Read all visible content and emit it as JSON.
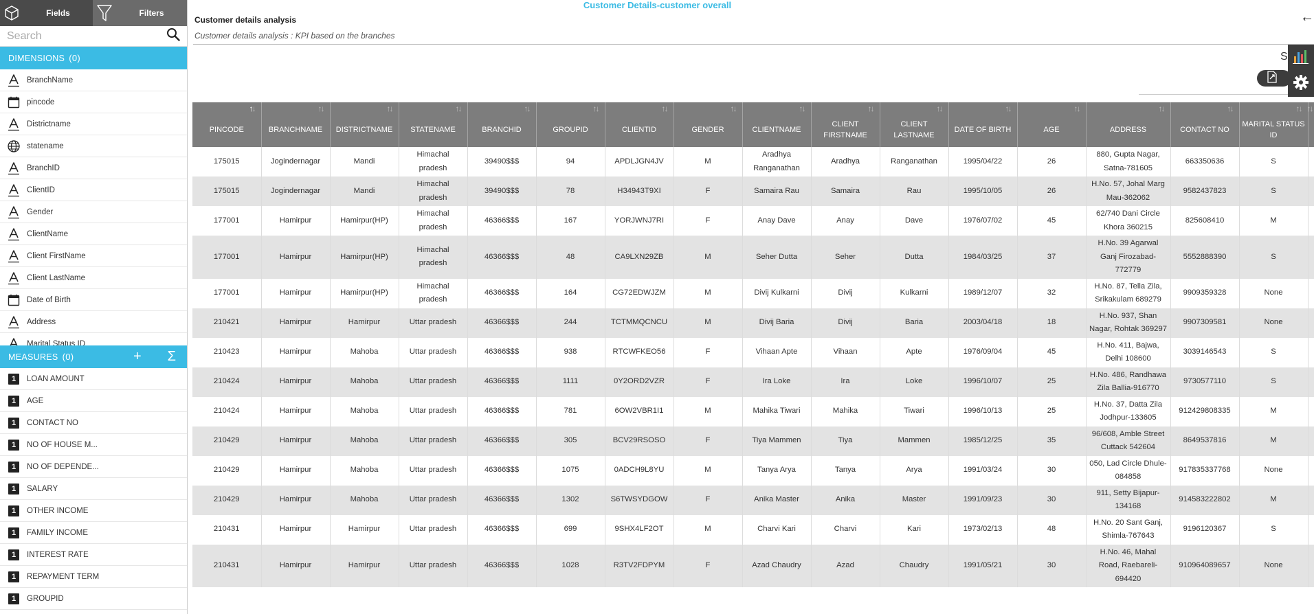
{
  "sidebar": {
    "tabs": {
      "fields": "Fields",
      "filters": "Filters"
    },
    "search": {
      "placeholder": "Search"
    },
    "dimensions": {
      "label": "DIMENSIONS",
      "count": "(0)",
      "items": [
        {
          "label": "BranchName",
          "icon": "text-a-icon"
        },
        {
          "label": "pincode",
          "icon": "calendar-icon"
        },
        {
          "label": "Districtname",
          "icon": "text-a-icon"
        },
        {
          "label": "statename",
          "icon": "globe-icon"
        },
        {
          "label": "BranchID",
          "icon": "text-a-icon"
        },
        {
          "label": "ClientID",
          "icon": "text-a-icon"
        },
        {
          "label": "Gender",
          "icon": "text-a-icon"
        },
        {
          "label": "ClientName",
          "icon": "text-a-icon"
        },
        {
          "label": "Client FirstName",
          "icon": "text-a-icon"
        },
        {
          "label": "Client LastName",
          "icon": "text-a-icon"
        },
        {
          "label": "Date of Birth",
          "icon": "calendar-icon"
        },
        {
          "label": "Address",
          "icon": "text-a-icon"
        },
        {
          "label": "Marital Status ID",
          "icon": "text-a-icon"
        }
      ]
    },
    "measures": {
      "label": "MEASURES",
      "count": "(0)",
      "add_icon": "+",
      "sum_icon": "Σ",
      "items": [
        {
          "label": "LOAN AMOUNT",
          "icon": "number-1-icon"
        },
        {
          "label": "AGE",
          "icon": "number-1-icon"
        },
        {
          "label": "CONTACT NO",
          "icon": "number-1-icon"
        },
        {
          "label": "NO OF HOUSE M...",
          "icon": "number-1-icon"
        },
        {
          "label": "NO OF DEPENDE...",
          "icon": "number-1-icon"
        },
        {
          "label": "SALARY",
          "icon": "number-1-icon"
        },
        {
          "label": "OTHER INCOME",
          "icon": "number-1-icon"
        },
        {
          "label": "FAMILY INCOME",
          "icon": "number-1-icon"
        },
        {
          "label": "INTEREST RATE",
          "icon": "number-1-icon"
        },
        {
          "label": "REPAYMENT TERM",
          "icon": "number-1-icon"
        },
        {
          "label": "GROUPID",
          "icon": "number-1-icon"
        }
      ]
    }
  },
  "report": {
    "title": "Customer Details-customer overall",
    "section_title": "Customer details analysis",
    "section_subtitle": "Customer details analysis : KPI based on the branches",
    "back_arrow": "←",
    "s_letter": "S"
  },
  "table": {
    "columns": [
      "PINCODE",
      "BRANCHNAME",
      "DISTRICTNAME",
      "STATENAME",
      "BRANCHID",
      "GROUPID",
      "CLIENTID",
      "GENDER",
      "CLIENTNAME",
      "CLIENT FIRSTNAME",
      "CLIENT LASTNAME",
      "DATE OF BIRTH",
      "AGE",
      "ADDRESS",
      "CONTACT NO",
      "MARITAL STATUS ID",
      ""
    ],
    "rows": [
      [
        "175015",
        "Jogindernagar",
        "Mandi",
        "Himachal pradesh",
        "39490$$$",
        "94",
        "APDLJGN4JV",
        "M",
        "Aradhya Ranganathan",
        "Aradhya",
        "Ranganathan",
        "1995/04/22",
        "26",
        "880, Gupta Nagar, Satna-781605",
        "663350636",
        "S",
        ""
      ],
      [
        "175015",
        "Jogindernagar",
        "Mandi",
        "Himachal pradesh",
        "39490$$$",
        "78",
        "H34943T9XI",
        "F",
        "Samaira Rau",
        "Samaira",
        "Rau",
        "1995/10/05",
        "26",
        "H.No. 57, Johal Marg Mau-362062",
        "9582437823",
        "S",
        ""
      ],
      [
        "177001",
        "Hamirpur",
        "Hamirpur(HP)",
        "Himachal pradesh",
        "46366$$$",
        "167",
        "YORJWNJ7RI",
        "F",
        "Anay Dave",
        "Anay",
        "Dave",
        "1976/07/02",
        "45",
        "62/740 Dani Circle Khora 360215",
        "825608410",
        "M",
        ""
      ],
      [
        "177001",
        "Hamirpur",
        "Hamirpur(HP)",
        "Himachal pradesh",
        "46366$$$",
        "48",
        "CA9LXN29ZB",
        "M",
        "Seher Dutta",
        "Seher",
        "Dutta",
        "1984/03/25",
        "37",
        "H.No. 39 Agarwal Ganj Firozabad-772779",
        "5552888390",
        "S",
        ""
      ],
      [
        "177001",
        "Hamirpur",
        "Hamirpur(HP)",
        "Himachal pradesh",
        "46366$$$",
        "164",
        "CG72EDWJZM",
        "M",
        "Divij Kulkarni",
        "Divij",
        "Kulkarni",
        "1989/12/07",
        "32",
        "H.No. 87, Tella Zila, Srikakulam 689279",
        "9909359328",
        "None",
        ""
      ],
      [
        "210421",
        "Hamirpur",
        "Hamirpur",
        "Uttar pradesh",
        "46366$$$",
        "244",
        "TCTMMQCNCU",
        "M",
        "Divij Baria",
        "Divij",
        "Baria",
        "2003/04/18",
        "18",
        "H.No. 937, Shan Nagar, Rohtak 369297",
        "9907309581",
        "None",
        ""
      ],
      [
        "210423",
        "Hamirpur",
        "Mahoba",
        "Uttar pradesh",
        "46366$$$",
        "938",
        "RTCWFKEO56",
        "F",
        "Vihaan Apte",
        "Vihaan",
        "Apte",
        "1976/09/04",
        "45",
        "H.No. 411, Bajwa, Delhi 108600",
        "3039146543",
        "S",
        ""
      ],
      [
        "210424",
        "Hamirpur",
        "Mahoba",
        "Uttar pradesh",
        "46366$$$",
        "1111",
        "0Y2ORD2VZR",
        "F",
        "Ira Loke",
        "Ira",
        "Loke",
        "1996/10/07",
        "25",
        "H.No. 486, Randhawa Zila Ballia-916770",
        "9730577110",
        "S",
        ""
      ],
      [
        "210424",
        "Hamirpur",
        "Mahoba",
        "Uttar pradesh",
        "46366$$$",
        "781",
        "6OW2VBR1I1",
        "M",
        "Mahika Tiwari",
        "Mahika",
        "Tiwari",
        "1996/10/13",
        "25",
        "H.No. 37, Datta Zila Jodhpur-133605",
        "912429808335",
        "M",
        ""
      ],
      [
        "210429",
        "Hamirpur",
        "Mahoba",
        "Uttar pradesh",
        "46366$$$",
        "305",
        "BCV29RSOSO",
        "F",
        "Tiya Mammen",
        "Tiya",
        "Mammen",
        "1985/12/25",
        "35",
        "96/608, Amble Street Cuttack 542604",
        "8649537816",
        "M",
        ""
      ],
      [
        "210429",
        "Hamirpur",
        "Mahoba",
        "Uttar pradesh",
        "46366$$$",
        "1075",
        "0ADCH9L8YU",
        "M",
        "Tanya Arya",
        "Tanya",
        "Arya",
        "1991/03/24",
        "30",
        "050, Lad Circle Dhule-084858",
        "917835337768",
        "None",
        ""
      ],
      [
        "210429",
        "Hamirpur",
        "Mahoba",
        "Uttar pradesh",
        "46366$$$",
        "1302",
        "S6TWSYDGOW",
        "F",
        "Anika Master",
        "Anika",
        "Master",
        "1991/09/23",
        "30",
        "911, Setty Bijapur-134168",
        "914583222802",
        "M",
        ""
      ],
      [
        "210431",
        "Hamirpur",
        "Hamirpur",
        "Uttar pradesh",
        "46366$$$",
        "699",
        "9SHX4LF2OT",
        "M",
        "Charvi Kari",
        "Charvi",
        "Kari",
        "1973/02/13",
        "48",
        "H.No. 20 Sant Ganj, Shimla-767643",
        "9196120367",
        "S",
        ""
      ],
      [
        "210431",
        "Hamirpur",
        "Hamirpur",
        "Uttar pradesh",
        "46366$$$",
        "1028",
        "R3TV2FDPYM",
        "F",
        "Azad Chaudry",
        "Azad",
        "Chaudry",
        "1991/05/21",
        "30",
        "H.No. 46, Mahal Road, Raebareli-694420",
        "910964089657",
        "None",
        ""
      ]
    ]
  }
}
